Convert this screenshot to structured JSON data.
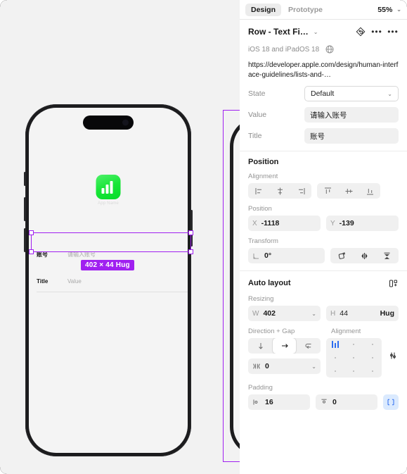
{
  "panel": {
    "tabs": [
      {
        "label": "Design",
        "active": true
      },
      {
        "label": "Prototype",
        "active": false
      }
    ],
    "zoom": "55%",
    "component": {
      "name": "Row - Text Fi…",
      "chevron": "⌄",
      "reset_icon": "reset-instance-icon",
      "library_text": "iOS 18 and iPadOS 18",
      "globe_icon": "globe-icon",
      "url": "https://developer.apple.com/design/human-interface-guidelines/lists-and-…"
    },
    "properties": [
      {
        "label": "State",
        "value": "Default",
        "type": "select"
      },
      {
        "label": "Value",
        "value": "请输入账号",
        "type": "text"
      },
      {
        "label": "Title",
        "value": "账号",
        "type": "text"
      }
    ],
    "position": {
      "title": "Position",
      "alignment_label": "Alignment",
      "align_buttons": [
        "align-left-icon",
        "align-horizontal-center-icon",
        "align-right-icon",
        "align-top-icon",
        "align-vertical-center-icon",
        "align-bottom-icon"
      ],
      "position_label": "Position",
      "x_prefix": "X",
      "x_value": "-1118",
      "y_prefix": "Y",
      "y_value": "-139",
      "transform_label": "Transform",
      "rotation_value": "0°",
      "transform_buttons": [
        "corner-radius-icon",
        "flip-horizontal-icon",
        "flip-vertical-icon"
      ]
    },
    "auto_layout": {
      "title": "Auto layout",
      "add_icon": "add-auto-layout-icon",
      "resizing_label": "Resizing",
      "w_prefix": "W",
      "w_value": "402",
      "h_prefix": "H",
      "h_value": "44",
      "h_mode": "Hug",
      "direction_label": "Direction + Gap",
      "direction_buttons": [
        "arrow-down-icon",
        "arrow-right-icon",
        "wrap-icon"
      ],
      "direction_selected_index": 1,
      "gap_value": "0",
      "alignment_label": "Alignment",
      "alignment_selected": "top-left",
      "advanced_icon": "advanced-layout-settings-icon",
      "padding_label": "Padding",
      "padding_h": "16",
      "padding_v": "0",
      "padding_toggle_icon": "independent-padding-icon"
    }
  },
  "canvas": {
    "app_icon_label": "App Name",
    "rows": [
      {
        "title": "账号",
        "value": "请输入账号"
      },
      {
        "title": "Title",
        "value": "Value"
      }
    ],
    "selection_badge": "402 × 44 Hug",
    "selection_color": "#a020f0"
  }
}
